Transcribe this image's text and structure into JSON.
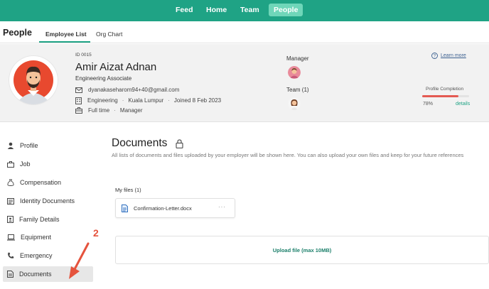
{
  "colors": {
    "brand": "#1fa385",
    "brand_light": "#6fd6b9",
    "accent_red": "#e45a52",
    "annotation": "#e5533d"
  },
  "topnav": {
    "items": [
      {
        "label": "Feed"
      },
      {
        "label": "Home"
      },
      {
        "label": "Team"
      },
      {
        "label": "People",
        "active": true
      }
    ]
  },
  "people": {
    "title": "People",
    "tabs": [
      {
        "label": "Employee List",
        "active": true
      },
      {
        "label": "Org Chart"
      }
    ]
  },
  "profile": {
    "id": "ID 0015",
    "name": "Amir Aizat Adnan",
    "role": "Engineering Associate",
    "email": "dyanakaseharom94+40@gmail.com",
    "department": "Engineering",
    "location": "Kuala Lumpur",
    "joined": "Joined 8 Feb 2023",
    "employment_type": "Full time",
    "level": "Manager",
    "manager_label": "Manager",
    "team_label": "Team (1)",
    "learn_more": "Learn more",
    "completion_label": "Profile Completion",
    "completion_percent": "78%",
    "completion_value": 0.78,
    "details_link": "details"
  },
  "sidebar": {
    "items": [
      {
        "label": "Profile",
        "icon": "person-icon"
      },
      {
        "label": "Job",
        "icon": "briefcase-icon"
      },
      {
        "label": "Compensation",
        "icon": "money-bag-icon"
      },
      {
        "label": "Identity Documents",
        "icon": "id-card-icon"
      },
      {
        "label": "Family Details",
        "icon": "family-book-icon"
      },
      {
        "label": "Equipment",
        "icon": "laptop-icon"
      },
      {
        "label": "Emergency",
        "icon": "phone-icon"
      },
      {
        "label": "Documents",
        "icon": "document-icon",
        "active": true
      }
    ]
  },
  "documents": {
    "title": "Documents",
    "description": "All lists of documents and files uploaded by your employer will be shown here. You can also upload your own files and keep for your future references",
    "my_files_label": "My files (1)",
    "files": [
      {
        "name": "Confirmation-Letter.docx",
        "menu": "···"
      }
    ],
    "upload_label": "Upload file (max 10MB)"
  },
  "annotation": {
    "number": "2"
  }
}
